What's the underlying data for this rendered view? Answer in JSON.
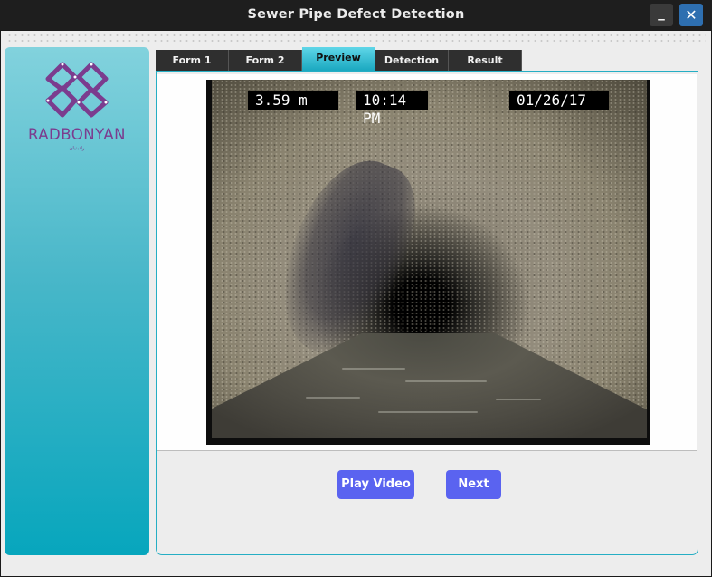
{
  "window": {
    "title": "Sewer Pipe Defect Detection",
    "minimize_glyph": "_",
    "close_glyph": "✕"
  },
  "sidebar": {
    "brand": "RADBONYAN",
    "brand_subtitle": "رادبنیان",
    "logo_icon": "radbonyan-logo-icon",
    "brand_color": "#7b3c8e"
  },
  "tabs": [
    {
      "label": "Form 1",
      "active": false
    },
    {
      "label": "Form 2",
      "active": false
    },
    {
      "label": "Preview",
      "active": true
    },
    {
      "label": "Detection",
      "active": false
    },
    {
      "label": "Result",
      "active": false
    }
  ],
  "video": {
    "distance": "3.59 m",
    "time": "10:14 PM",
    "date": "01/26/17"
  },
  "actions": {
    "play_label": "Play Video",
    "next_label": "Next"
  },
  "colors": {
    "accent": "#25aec4",
    "button": "#5a63f0",
    "tab_dark": "#2f2f2f",
    "close_button": "#2e6fb0"
  }
}
